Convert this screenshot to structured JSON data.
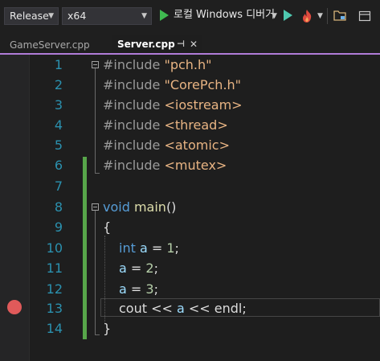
{
  "toolbar": {
    "config": "Release",
    "platform": "x64",
    "run_label": "로컬 Windows 디버거",
    "colors": {
      "play": "#3fb950",
      "flame": "#e04a3f"
    }
  },
  "tabs": [
    {
      "label": "GameServer.cpp",
      "active": false
    },
    {
      "label": "Server.cpp",
      "active": true
    }
  ],
  "editor": {
    "line_numbers": [
      "1",
      "2",
      "3",
      "4",
      "5",
      "6",
      "7",
      "8",
      "9",
      "10",
      "11",
      "12",
      "13",
      "14"
    ],
    "code": {
      "l1_dir": "#include",
      "l1_arg": "\"pch.h\"",
      "l2_dir": "#include",
      "l2_arg": "\"CorePch.h\"",
      "l3_dir": "#include",
      "l3_arg": "<iostream>",
      "l4_dir": "#include",
      "l4_arg": "<thread>",
      "l5_dir": "#include",
      "l5_arg": "<atomic>",
      "l6_dir": "#include",
      "l6_arg": "<mutex>",
      "l8_kw": "void",
      "l8_fn": "main",
      "l8_rest": "()",
      "l9": "{",
      "l10_kw": "int",
      "l10_var": "a",
      "l10_op": " = ",
      "l10_num": "1",
      "l10_end": ";",
      "l11_var": "a",
      "l11_op": " = ",
      "l11_num": "2",
      "l11_end": ";",
      "l12_var": "a",
      "l12_op": " = ",
      "l12_num": "3",
      "l12_end": ";",
      "l13_a": "cout",
      "l13_b": " << ",
      "l13_var": "a",
      "l13_c": " << ",
      "l13_d": "endl",
      "l13_end": ";",
      "l14": "}"
    },
    "breakpoint_line": "13"
  }
}
